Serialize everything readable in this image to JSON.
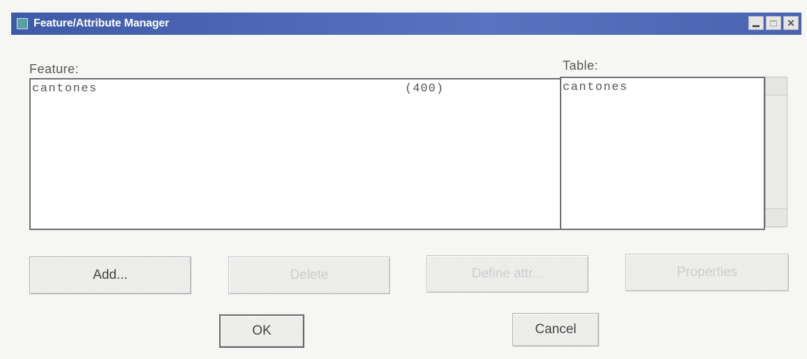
{
  "window": {
    "title": "Feature/Attribute Manager",
    "controls": {
      "minimize_icon": "minimize-icon",
      "maximize_icon": "maximize-icon",
      "close_icon": "close-icon",
      "close_glyph": "✕"
    }
  },
  "feature": {
    "label": "Feature:",
    "items": [
      {
        "name": "cantones",
        "count": "(400)"
      }
    ]
  },
  "table": {
    "label": "Table:",
    "items": [
      {
        "name": "cantones"
      }
    ]
  },
  "buttons": {
    "add": "Add...",
    "delete": "Delete",
    "define_attr": "Define attr...",
    "properties": "Properties"
  },
  "dialog": {
    "ok": "OK",
    "cancel": "Cancel"
  },
  "colors": {
    "titlebar": "#3e5aa8",
    "window_bg": "#f6f6f4",
    "disabled_text": "#cdcdcd"
  }
}
